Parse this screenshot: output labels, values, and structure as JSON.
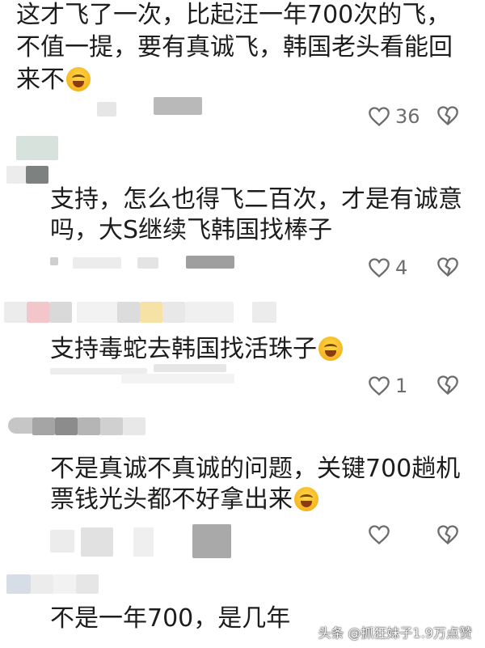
{
  "comments": [
    {
      "lines": [
        "这才飞了一次，比起汪一年700次的飞，",
        "不值一提，要有真诚飞，韩国老头看能回",
        "来不"
      ],
      "emoji": "laugh-cry-emoji",
      "likes": "36"
    },
    {
      "lines": [
        "支持，怎么也得飞二百次，才是有诚意",
        "吗，大S继续飞韩国找棒子"
      ],
      "likes": "4"
    },
    {
      "lines": [
        "支持毒蛇去韩国找活珠子"
      ],
      "emoji": "laugh-cry-emoji",
      "likes": "1"
    },
    {
      "lines": [
        "不是真诚不真诚的问题，关键700趟机",
        "票钱光头都不好拿出来"
      ],
      "emoji": "laugh-cry-emoji",
      "likes": ""
    },
    {
      "lines": [
        "不是一年700，是几年"
      ]
    }
  ],
  "watermark": "头条 @抓狂妹子1.9万点赞",
  "colors": {
    "text": "#1d1d1d",
    "icon": "#6d6d6d",
    "blur_gray": "#c8c8c8",
    "blur_pink": "#f3c6cc",
    "blur_yellow": "#f7e2a6"
  }
}
